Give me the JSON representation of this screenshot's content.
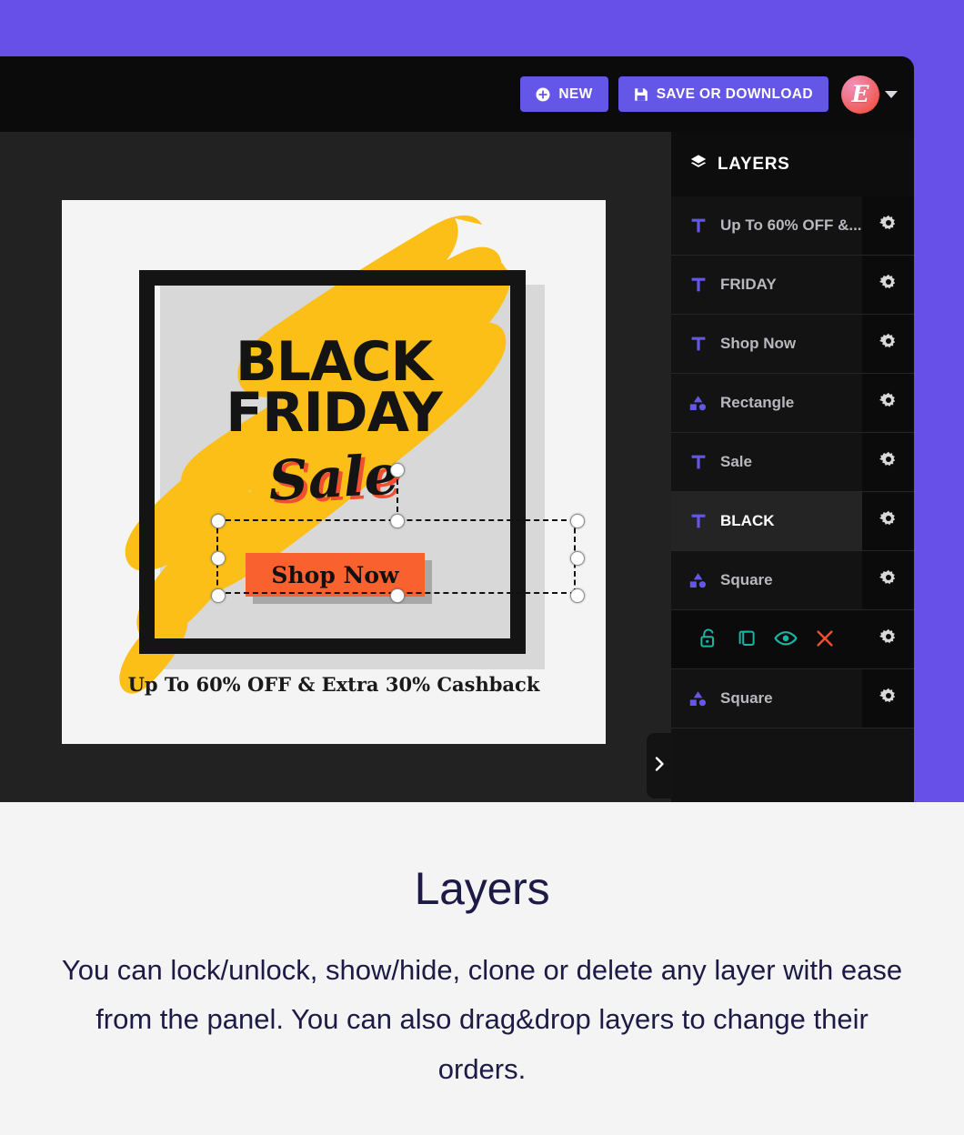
{
  "theme": {
    "backdrop_purple": "#6750e8",
    "accent_blue": "#6457e8",
    "panel_black": "#121212",
    "workspace_gray": "#222222",
    "teal_action": "#19b4a2",
    "red_action": "#f2502f",
    "caption_navy": "#1d1b45"
  },
  "toolbar": {
    "new_label": "NEW",
    "new_icon": "plus-circle-icon",
    "save_label": "SAVE OR DOWNLOAD",
    "save_icon": "floppy-disk-icon",
    "avatar_letter": "E",
    "avatar_icon": "user-avatar",
    "caret_icon": "chevron-down-icon"
  },
  "panel": {
    "title": "LAYERS",
    "title_icon": "layers-stack-icon",
    "gear_icon": "gear-icon",
    "collapse_icon": "chevron-right-icon",
    "layers": [
      {
        "label": "Up To 60% OFF &...",
        "type": "text",
        "icon": "text-layer-icon",
        "selected": false,
        "expanded": false
      },
      {
        "label": "FRIDAY",
        "type": "text",
        "icon": "text-layer-icon",
        "selected": false,
        "expanded": false
      },
      {
        "label": "Shop Now",
        "type": "text",
        "icon": "text-layer-icon",
        "selected": false,
        "expanded": false
      },
      {
        "label": "Rectangle",
        "type": "shape",
        "icon": "shapes-layer-icon",
        "selected": false,
        "expanded": false
      },
      {
        "label": "Sale",
        "type": "text",
        "icon": "text-layer-icon",
        "selected": false,
        "expanded": false
      },
      {
        "label": "BLACK",
        "type": "text",
        "icon": "text-layer-icon",
        "selected": true,
        "expanded": false
      },
      {
        "label": "Square",
        "type": "shape",
        "icon": "shapes-layer-icon",
        "selected": false,
        "expanded": true
      },
      {
        "label": "Square",
        "type": "shape",
        "icon": "shapes-layer-icon",
        "selected": false,
        "expanded": false
      }
    ],
    "actions": [
      {
        "name": "lock-toggle",
        "icon": "unlock-icon",
        "color": "#19b4a2"
      },
      {
        "name": "clone-layer",
        "icon": "copy-icon",
        "color": "#19b4a2"
      },
      {
        "name": "visibility-toggle",
        "icon": "eye-icon",
        "color": "#19b4a2"
      },
      {
        "name": "delete-layer",
        "icon": "close-x-icon",
        "color": "#f2502f"
      }
    ]
  },
  "artwork": {
    "headline_1": "BLACK",
    "headline_2": "FRIDAY",
    "script_word": "Sale",
    "cta_label": "Shop Now",
    "caption": "Up To 60% OFF & Extra 30% Cashback"
  },
  "caption": {
    "title": "Layers",
    "body": "You can lock/unlock, show/hide, clone or delete any layer with ease from the panel. You can also drag&drop layers to change their orders."
  }
}
